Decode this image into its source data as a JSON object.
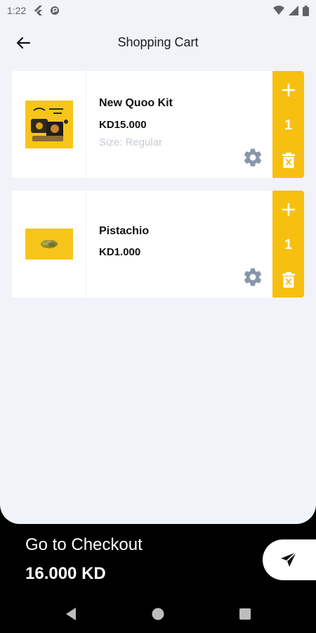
{
  "status_bar": {
    "time": "1:22"
  },
  "header": {
    "title": "Shopping Cart"
  },
  "cart": {
    "items": [
      {
        "name": "New Quoo Kit",
        "price": "KD15.000",
        "size": "Size: Regular",
        "quantity": "1"
      },
      {
        "name": "Pistachio",
        "price": "KD1.000",
        "quantity": "1"
      }
    ]
  },
  "checkout": {
    "label": "Go to Checkout",
    "total": "16.000 KD"
  },
  "colors": {
    "accent": "#f7bf10",
    "background": "#f0f4f8",
    "settings_icon": "#8a96a8",
    "footer": "#000000"
  },
  "icons": {
    "back": "arrow-left-icon",
    "settings": "gear-icon",
    "add": "plus-icon",
    "delete": "trash-icon",
    "send": "send-icon"
  }
}
